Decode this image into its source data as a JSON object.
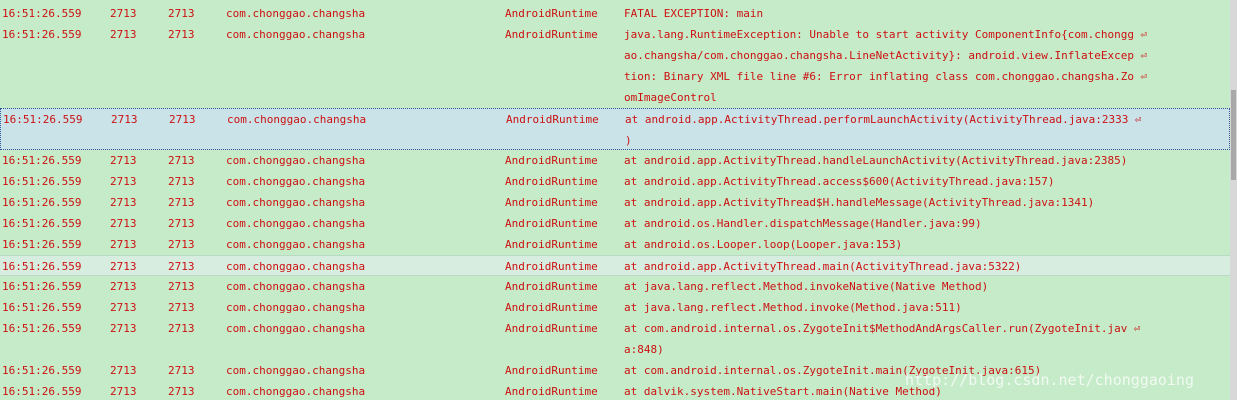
{
  "entries": [
    {
      "time": "16:51:26.559",
      "pid": "2713",
      "tid": "2713",
      "app": "com.chonggao.changsha",
      "tag": "AndroidRuntime",
      "lines": [
        "FATAL EXCEPTION: main"
      ]
    },
    {
      "time": "16:51:26.559",
      "pid": "2713",
      "tid": "2713",
      "app": "com.chonggao.changsha",
      "tag": "AndroidRuntime",
      "lines": [
        "java.lang.RuntimeException: Unable to start activity ComponentInfo{com.chongg ⏎",
        "ao.changsha/com.chonggao.changsha.LineNetActivity}: android.view.InflateExcep ⏎",
        "tion: Binary XML file line #6: Error inflating class com.chonggao.changsha.Zo ⏎",
        "omImageControl"
      ]
    },
    {
      "time": "16:51:26.559",
      "pid": "2713",
      "tid": "2713",
      "app": "com.chonggao.changsha",
      "tag": "AndroidRuntime",
      "lines": [
        "at android.app.ActivityThread.performLaunchActivity(ActivityThread.java:2333 ⏎",
        ")"
      ]
    },
    {
      "time": "16:51:26.559",
      "pid": "2713",
      "tid": "2713",
      "app": "com.chonggao.changsha",
      "tag": "AndroidRuntime",
      "lines": [
        "at android.app.ActivityThread.handleLaunchActivity(ActivityThread.java:2385)"
      ]
    },
    {
      "time": "16:51:26.559",
      "pid": "2713",
      "tid": "2713",
      "app": "com.chonggao.changsha",
      "tag": "AndroidRuntime",
      "lines": [
        "at android.app.ActivityThread.access$600(ActivityThread.java:157)"
      ]
    },
    {
      "time": "16:51:26.559",
      "pid": "2713",
      "tid": "2713",
      "app": "com.chonggao.changsha",
      "tag": "AndroidRuntime",
      "lines": [
        "at android.app.ActivityThread$H.handleMessage(ActivityThread.java:1341)"
      ]
    },
    {
      "time": "16:51:26.559",
      "pid": "2713",
      "tid": "2713",
      "app": "com.chonggao.changsha",
      "tag": "AndroidRuntime",
      "lines": [
        "at android.os.Handler.dispatchMessage(Handler.java:99)"
      ]
    },
    {
      "time": "16:51:26.559",
      "pid": "2713",
      "tid": "2713",
      "app": "com.chonggao.changsha",
      "tag": "AndroidRuntime",
      "lines": [
        "at android.os.Looper.loop(Looper.java:153)"
      ]
    },
    {
      "time": "16:51:26.559",
      "pid": "2713",
      "tid": "2713",
      "app": "com.chonggao.changsha",
      "tag": "AndroidRuntime",
      "lines": [
        "at android.app.ActivityThread.main(ActivityThread.java:5322)"
      ]
    },
    {
      "time": "16:51:26.559",
      "pid": "2713",
      "tid": "2713",
      "app": "com.chonggao.changsha",
      "tag": "AndroidRuntime",
      "lines": [
        "at java.lang.reflect.Method.invokeNative(Native Method)"
      ]
    },
    {
      "time": "16:51:26.559",
      "pid": "2713",
      "tid": "2713",
      "app": "com.chonggao.changsha",
      "tag": "AndroidRuntime",
      "lines": [
        "at java.lang.reflect.Method.invoke(Method.java:511)"
      ]
    },
    {
      "time": "16:51:26.559",
      "pid": "2713",
      "tid": "2713",
      "app": "com.chonggao.changsha",
      "tag": "AndroidRuntime",
      "lines": [
        "at com.android.internal.os.ZygoteInit$MethodAndArgsCaller.run(ZygoteInit.jav ⏎",
        "a:848)"
      ]
    },
    {
      "time": "16:51:26.559",
      "pid": "2713",
      "tid": "2713",
      "app": "com.chonggao.changsha",
      "tag": "AndroidRuntime",
      "lines": [
        "at com.android.internal.os.ZygoteInit.main(ZygoteInit.java:615)"
      ]
    },
    {
      "time": "16:51:26.559",
      "pid": "2713",
      "tid": "2713",
      "app": "com.chonggao.changsha",
      "tag": "AndroidRuntime",
      "lines": [
        "at dalvik.system.NativeStart.main(Native Method)"
      ]
    }
  ],
  "selected_index": 2,
  "hover_index": 8,
  "watermark": "http://blog.csdn.net/chonggaoing",
  "colors": {
    "background": "#c6ebc9",
    "text": "#cc1111",
    "selection_border": "#335599"
  }
}
